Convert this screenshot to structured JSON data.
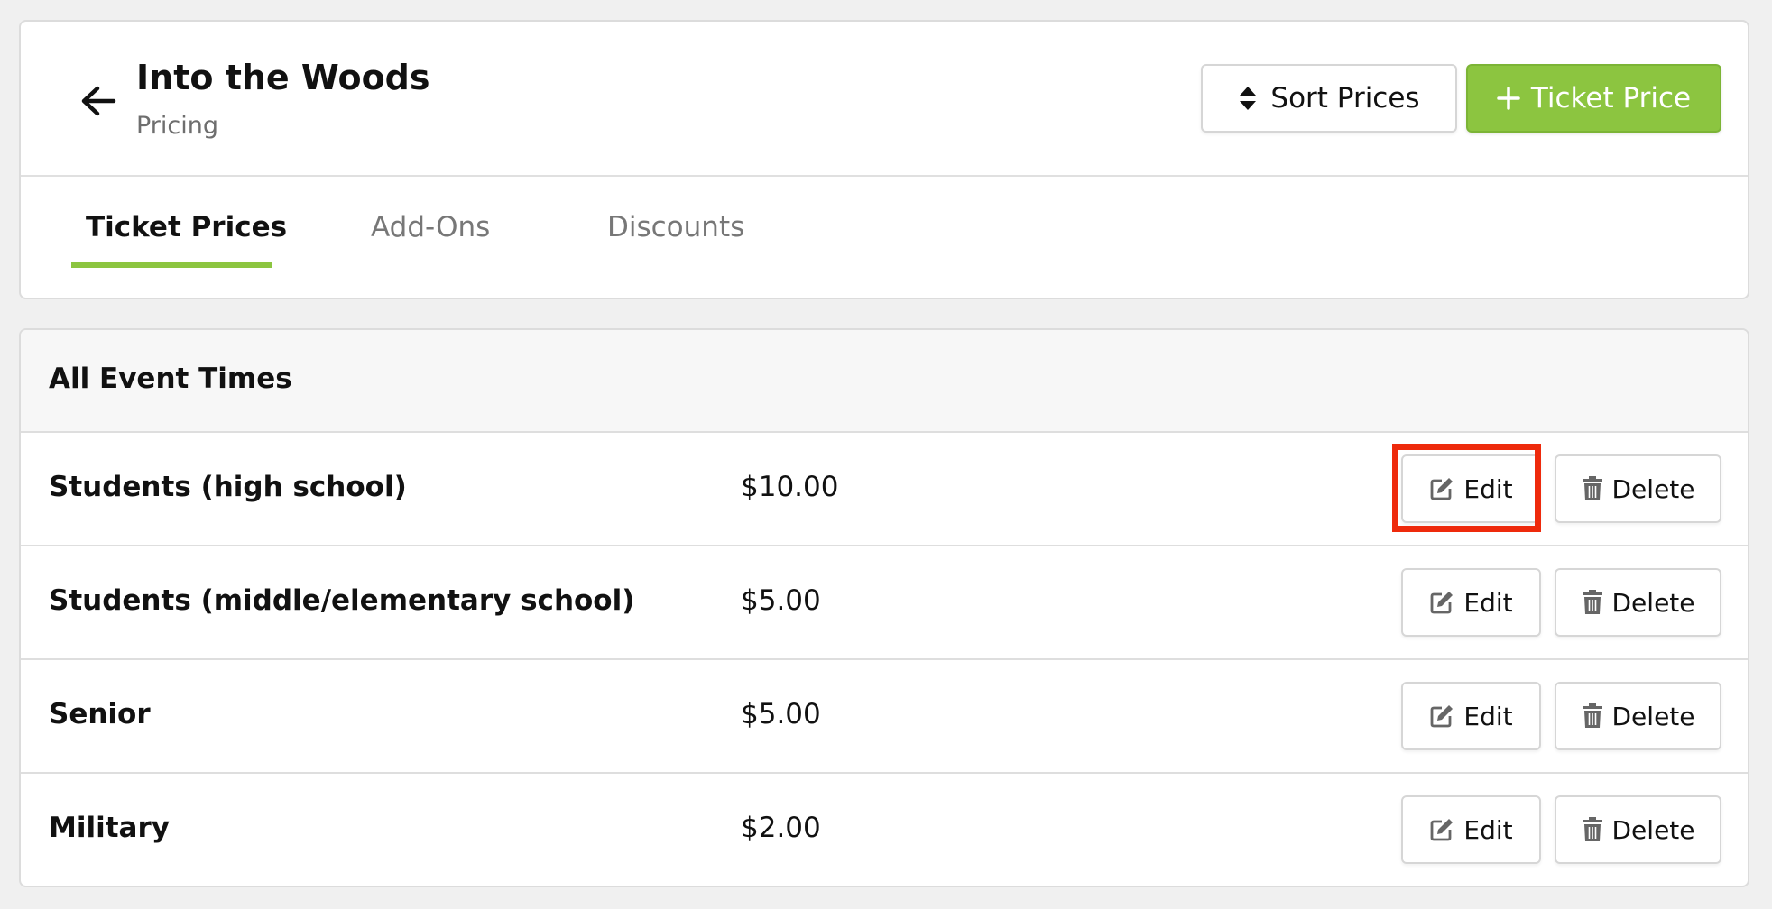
{
  "header": {
    "title": "Into the Woods",
    "subtitle": "Pricing",
    "sort_label": "Sort Prices",
    "add_label": "Ticket Price"
  },
  "tabs": [
    {
      "label": "Ticket Prices",
      "active": true
    },
    {
      "label": "Add-Ons",
      "active": false
    },
    {
      "label": "Discounts",
      "active": false
    }
  ],
  "section": {
    "title": "All Event Times"
  },
  "prices": [
    {
      "name": "Students (high school)",
      "price": "$10.00",
      "edit_label": "Edit",
      "delete_label": "Delete",
      "highlighted": true
    },
    {
      "name": "Students (middle/elementary school)",
      "price": "$5.00",
      "edit_label": "Edit",
      "delete_label": "Delete",
      "highlighted": false
    },
    {
      "name": "Senior",
      "price": "$5.00",
      "edit_label": "Edit",
      "delete_label": "Delete",
      "highlighted": false
    },
    {
      "name": "Military",
      "price": "$2.00",
      "edit_label": "Edit",
      "delete_label": "Delete",
      "highlighted": false
    }
  ],
  "colors": {
    "accent": "#8cc540",
    "highlight": "#ee2a0c",
    "background": "#f0f0f0"
  },
  "icons": {
    "back": "arrow-left-icon",
    "sort": "sort-icon",
    "add": "plus-icon",
    "edit": "edit-icon",
    "delete": "trash-icon"
  }
}
